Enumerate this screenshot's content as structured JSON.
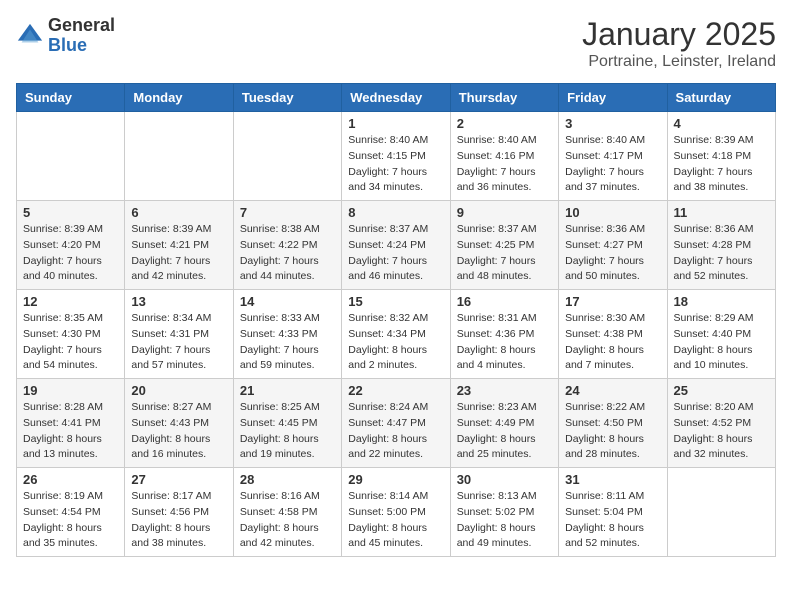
{
  "logo": {
    "general": "General",
    "blue": "Blue"
  },
  "title": "January 2025",
  "location": "Portraine, Leinster, Ireland",
  "days_of_week": [
    "Sunday",
    "Monday",
    "Tuesday",
    "Wednesday",
    "Thursday",
    "Friday",
    "Saturday"
  ],
  "weeks": [
    [
      {
        "day": "",
        "sunrise": "",
        "sunset": "",
        "daylight": ""
      },
      {
        "day": "",
        "sunrise": "",
        "sunset": "",
        "daylight": ""
      },
      {
        "day": "",
        "sunrise": "",
        "sunset": "",
        "daylight": ""
      },
      {
        "day": "1",
        "sunrise": "Sunrise: 8:40 AM",
        "sunset": "Sunset: 4:15 PM",
        "daylight": "Daylight: 7 hours and 34 minutes."
      },
      {
        "day": "2",
        "sunrise": "Sunrise: 8:40 AM",
        "sunset": "Sunset: 4:16 PM",
        "daylight": "Daylight: 7 hours and 36 minutes."
      },
      {
        "day": "3",
        "sunrise": "Sunrise: 8:40 AM",
        "sunset": "Sunset: 4:17 PM",
        "daylight": "Daylight: 7 hours and 37 minutes."
      },
      {
        "day": "4",
        "sunrise": "Sunrise: 8:39 AM",
        "sunset": "Sunset: 4:18 PM",
        "daylight": "Daylight: 7 hours and 38 minutes."
      }
    ],
    [
      {
        "day": "5",
        "sunrise": "Sunrise: 8:39 AM",
        "sunset": "Sunset: 4:20 PM",
        "daylight": "Daylight: 7 hours and 40 minutes."
      },
      {
        "day": "6",
        "sunrise": "Sunrise: 8:39 AM",
        "sunset": "Sunset: 4:21 PM",
        "daylight": "Daylight: 7 hours and 42 minutes."
      },
      {
        "day": "7",
        "sunrise": "Sunrise: 8:38 AM",
        "sunset": "Sunset: 4:22 PM",
        "daylight": "Daylight: 7 hours and 44 minutes."
      },
      {
        "day": "8",
        "sunrise": "Sunrise: 8:37 AM",
        "sunset": "Sunset: 4:24 PM",
        "daylight": "Daylight: 7 hours and 46 minutes."
      },
      {
        "day": "9",
        "sunrise": "Sunrise: 8:37 AM",
        "sunset": "Sunset: 4:25 PM",
        "daylight": "Daylight: 7 hours and 48 minutes."
      },
      {
        "day": "10",
        "sunrise": "Sunrise: 8:36 AM",
        "sunset": "Sunset: 4:27 PM",
        "daylight": "Daylight: 7 hours and 50 minutes."
      },
      {
        "day": "11",
        "sunrise": "Sunrise: 8:36 AM",
        "sunset": "Sunset: 4:28 PM",
        "daylight": "Daylight: 7 hours and 52 minutes."
      }
    ],
    [
      {
        "day": "12",
        "sunrise": "Sunrise: 8:35 AM",
        "sunset": "Sunset: 4:30 PM",
        "daylight": "Daylight: 7 hours and 54 minutes."
      },
      {
        "day": "13",
        "sunrise": "Sunrise: 8:34 AM",
        "sunset": "Sunset: 4:31 PM",
        "daylight": "Daylight: 7 hours and 57 minutes."
      },
      {
        "day": "14",
        "sunrise": "Sunrise: 8:33 AM",
        "sunset": "Sunset: 4:33 PM",
        "daylight": "Daylight: 7 hours and 59 minutes."
      },
      {
        "day": "15",
        "sunrise": "Sunrise: 8:32 AM",
        "sunset": "Sunset: 4:34 PM",
        "daylight": "Daylight: 8 hours and 2 minutes."
      },
      {
        "day": "16",
        "sunrise": "Sunrise: 8:31 AM",
        "sunset": "Sunset: 4:36 PM",
        "daylight": "Daylight: 8 hours and 4 minutes."
      },
      {
        "day": "17",
        "sunrise": "Sunrise: 8:30 AM",
        "sunset": "Sunset: 4:38 PM",
        "daylight": "Daylight: 8 hours and 7 minutes."
      },
      {
        "day": "18",
        "sunrise": "Sunrise: 8:29 AM",
        "sunset": "Sunset: 4:40 PM",
        "daylight": "Daylight: 8 hours and 10 minutes."
      }
    ],
    [
      {
        "day": "19",
        "sunrise": "Sunrise: 8:28 AM",
        "sunset": "Sunset: 4:41 PM",
        "daylight": "Daylight: 8 hours and 13 minutes."
      },
      {
        "day": "20",
        "sunrise": "Sunrise: 8:27 AM",
        "sunset": "Sunset: 4:43 PM",
        "daylight": "Daylight: 8 hours and 16 minutes."
      },
      {
        "day": "21",
        "sunrise": "Sunrise: 8:25 AM",
        "sunset": "Sunset: 4:45 PM",
        "daylight": "Daylight: 8 hours and 19 minutes."
      },
      {
        "day": "22",
        "sunrise": "Sunrise: 8:24 AM",
        "sunset": "Sunset: 4:47 PM",
        "daylight": "Daylight: 8 hours and 22 minutes."
      },
      {
        "day": "23",
        "sunrise": "Sunrise: 8:23 AM",
        "sunset": "Sunset: 4:49 PM",
        "daylight": "Daylight: 8 hours and 25 minutes."
      },
      {
        "day": "24",
        "sunrise": "Sunrise: 8:22 AM",
        "sunset": "Sunset: 4:50 PM",
        "daylight": "Daylight: 8 hours and 28 minutes."
      },
      {
        "day": "25",
        "sunrise": "Sunrise: 8:20 AM",
        "sunset": "Sunset: 4:52 PM",
        "daylight": "Daylight: 8 hours and 32 minutes."
      }
    ],
    [
      {
        "day": "26",
        "sunrise": "Sunrise: 8:19 AM",
        "sunset": "Sunset: 4:54 PM",
        "daylight": "Daylight: 8 hours and 35 minutes."
      },
      {
        "day": "27",
        "sunrise": "Sunrise: 8:17 AM",
        "sunset": "Sunset: 4:56 PM",
        "daylight": "Daylight: 8 hours and 38 minutes."
      },
      {
        "day": "28",
        "sunrise": "Sunrise: 8:16 AM",
        "sunset": "Sunset: 4:58 PM",
        "daylight": "Daylight: 8 hours and 42 minutes."
      },
      {
        "day": "29",
        "sunrise": "Sunrise: 8:14 AM",
        "sunset": "Sunset: 5:00 PM",
        "daylight": "Daylight: 8 hours and 45 minutes."
      },
      {
        "day": "30",
        "sunrise": "Sunrise: 8:13 AM",
        "sunset": "Sunset: 5:02 PM",
        "daylight": "Daylight: 8 hours and 49 minutes."
      },
      {
        "day": "31",
        "sunrise": "Sunrise: 8:11 AM",
        "sunset": "Sunset: 5:04 PM",
        "daylight": "Daylight: 8 hours and 52 minutes."
      },
      {
        "day": "",
        "sunrise": "",
        "sunset": "",
        "daylight": ""
      }
    ]
  ]
}
